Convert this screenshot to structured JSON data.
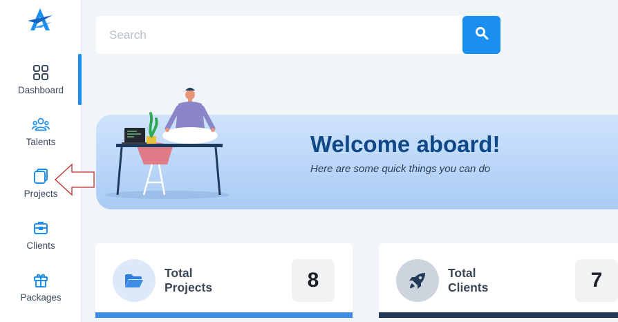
{
  "colors": {
    "accent": "#1a8ff0",
    "title": "#0f4886",
    "projects_bar": "#3d8de6",
    "clients_bar": "#243a58"
  },
  "sidebar": {
    "items": [
      {
        "label": "Dashboard",
        "icon": "grid-icon",
        "active": true
      },
      {
        "label": "Talents",
        "icon": "users-icon"
      },
      {
        "label": "Projects",
        "icon": "projects-icon"
      },
      {
        "label": "Clients",
        "icon": "briefcase-icon"
      },
      {
        "label": "Packages",
        "icon": "gift-icon"
      }
    ]
  },
  "search": {
    "placeholder": "Search",
    "value": ""
  },
  "banner": {
    "title": "Welcome aboard!",
    "subtitle": "Here are some quick things you can do"
  },
  "stats": [
    {
      "label_line1": "Total",
      "label_line2": "Projects",
      "value": "8",
      "icon": "folder-open-icon"
    },
    {
      "label_line1": "Total",
      "label_line2": "Clients",
      "value": "7",
      "icon": "rocket-icon"
    }
  ]
}
